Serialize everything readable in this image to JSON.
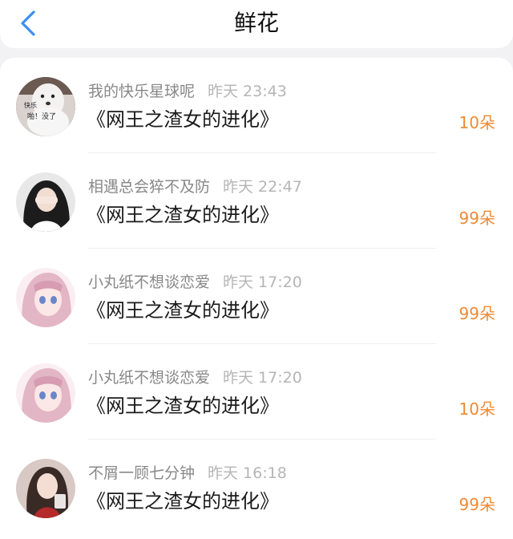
{
  "header": {
    "title": "鲜花",
    "back_icon": "chevron-left-icon",
    "accent_color": "#3c8ef3"
  },
  "records": [
    {
      "user": "我的快乐星球呢",
      "time": "昨天 23:43",
      "book": "《网王之渣女的进化》",
      "amount": "10朵",
      "avatar_icon": "dog-sticker-avatar",
      "avatar_caption_top": "快乐",
      "avatar_caption_bottom": "啪！没了"
    },
    {
      "user": "相遇总会猝不及防",
      "time": "昨天 22:47",
      "book": "《网王之渣女的进化》",
      "amount": "99朵",
      "avatar_icon": "girl-covering-face-avatar"
    },
    {
      "user": "小丸纸不想谈恋爱",
      "time": "昨天 17:20",
      "book": "《网王之渣女的进化》",
      "amount": "99朵",
      "avatar_icon": "anime-girl-avatar"
    },
    {
      "user": "小丸纸不想谈恋爱",
      "time": "昨天 17:20",
      "book": "《网王之渣女的进化》",
      "amount": "10朵",
      "avatar_icon": "anime-girl-avatar"
    },
    {
      "user": "不屑一顾七分钟",
      "time": "昨天 16:18",
      "book": "《网王之渣女的进化》",
      "amount": "99朵",
      "avatar_icon": "girl-portrait-avatar"
    }
  ],
  "colors": {
    "amount": "#ef8a33",
    "username": "#888888",
    "timestamp": "#b5b5b5",
    "book_title": "#1a1a1a",
    "background": "#f2f2f4"
  }
}
